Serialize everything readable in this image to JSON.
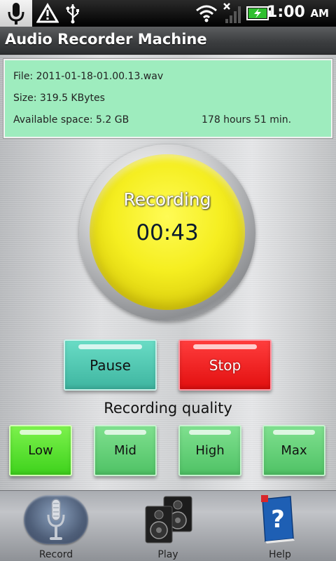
{
  "statusbar": {
    "icons": [
      "microphone-icon",
      "warning-icon",
      "usb-icon",
      "wifi-icon",
      "signal-off-icon",
      "battery-charging-icon"
    ],
    "time": "1:00",
    "ampm": "AM"
  },
  "app": {
    "title": "Audio Recorder Machine"
  },
  "info": {
    "file": "File: 2011-01-18-01.00.13.wav",
    "size": "Size: 319.5 KBytes",
    "space": "Available space: 5.2 GB",
    "hours": "178 hours 51 min."
  },
  "recorder": {
    "status": "Recording",
    "elapsed": "00:43",
    "indicator_color": "#f5ee20"
  },
  "controls": {
    "pause_label": "Pause",
    "stop_label": "Stop",
    "pause_color": "#4fc7b1",
    "stop_color": "#f01d1d"
  },
  "quality": {
    "label": "Recording quality",
    "options": [
      {
        "label": "Low",
        "selected": true
      },
      {
        "label": "Mid",
        "selected": false
      },
      {
        "label": "High",
        "selected": false
      },
      {
        "label": "Max",
        "selected": false
      }
    ]
  },
  "nav": {
    "items": [
      {
        "label": "Record",
        "icon": "microphone-icon",
        "selected": true
      },
      {
        "label": "Play",
        "icon": "speakers-icon",
        "selected": false
      },
      {
        "label": "Help",
        "icon": "help-book-icon",
        "selected": false
      }
    ]
  }
}
